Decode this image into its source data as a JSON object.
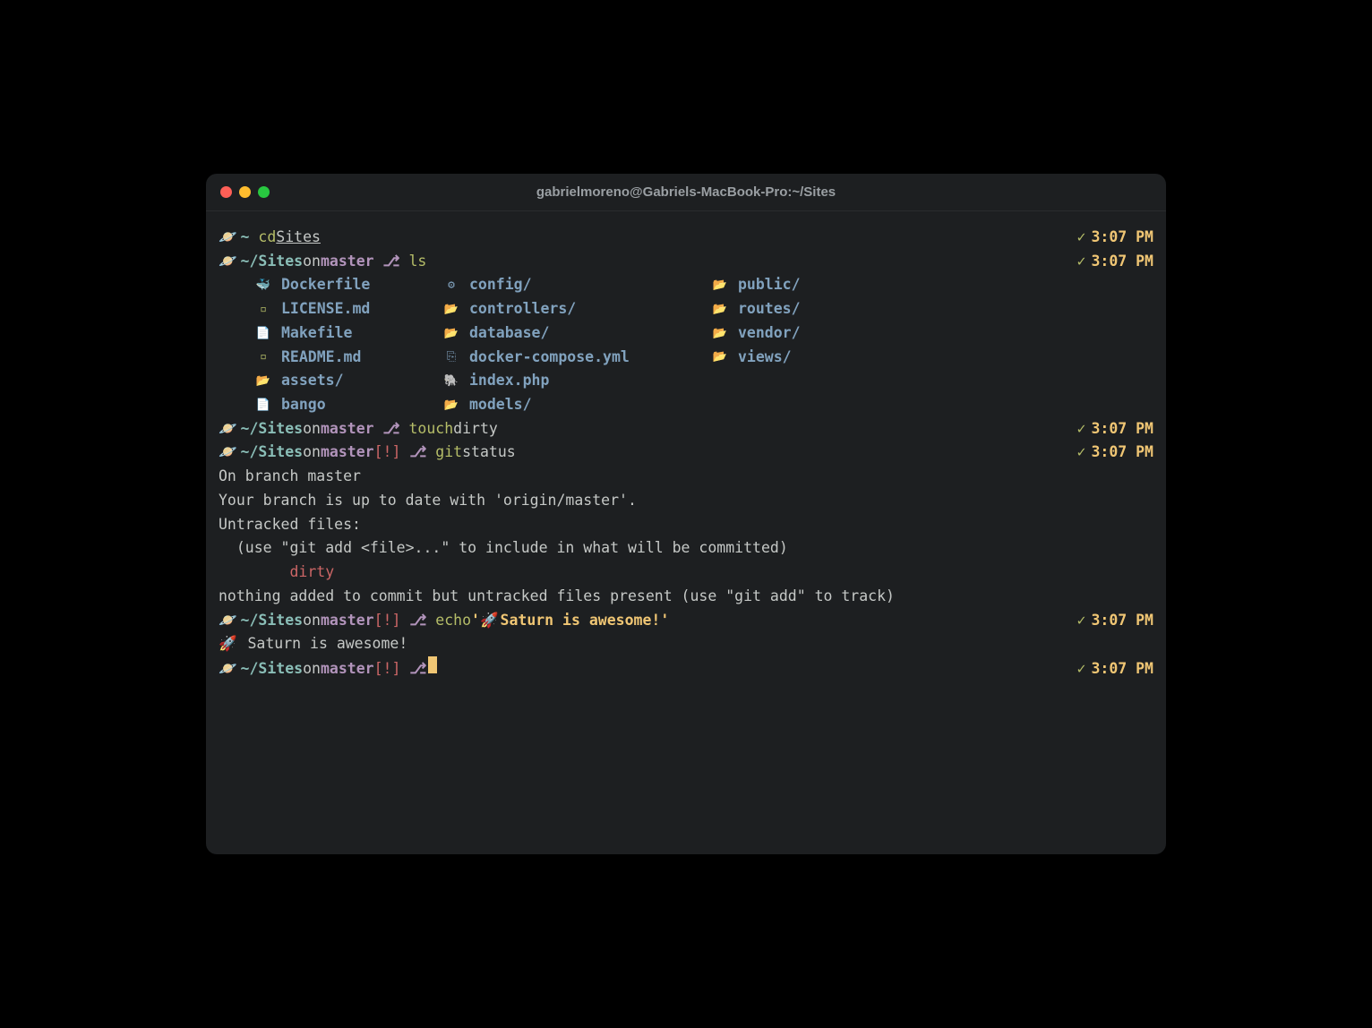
{
  "title": "gabrielmoreno@Gabriels-MacBook-Pro:~/Sites",
  "planet_icon": "🪐",
  "rocket_icon": "🚀",
  "check_icon": "✓",
  "branch_glyph": "⎇",
  "prompts": [
    {
      "path": "~",
      "on": "",
      "branch": "",
      "dirty": "",
      "cmd": "cd ",
      "cmd_arg": "Sites",
      "time": "3:07 PM"
    },
    {
      "path": "~/Sites",
      "on": " on ",
      "branch": "master",
      "dirty": "",
      "cmd": "ls",
      "cmd_arg": "",
      "time": "3:07 PM"
    }
  ],
  "ls": {
    "col1": [
      {
        "icon": "docker",
        "name": "Dockerfile"
      },
      {
        "icon": "md",
        "name": "LICENSE.md"
      },
      {
        "icon": "file",
        "name": "Makefile"
      },
      {
        "icon": "md",
        "name": "README.md"
      },
      {
        "icon": "folder",
        "name": "assets/"
      },
      {
        "icon": "file",
        "name": "bango"
      }
    ],
    "col2": [
      {
        "icon": "config",
        "name": "config/"
      },
      {
        "icon": "folder",
        "name": "controllers/"
      },
      {
        "icon": "folder",
        "name": "database/"
      },
      {
        "icon": "yml",
        "name": "docker-compose.yml"
      },
      {
        "icon": "php",
        "name": "index.php"
      },
      {
        "icon": "folder",
        "name": "models/"
      }
    ],
    "col3": [
      {
        "icon": "folder",
        "name": "public/"
      },
      {
        "icon": "folder",
        "name": "routes/"
      },
      {
        "icon": "folder",
        "name": "vendor/"
      },
      {
        "icon": "folder",
        "name": "views/"
      }
    ]
  },
  "prompt_touch": {
    "path": "~/Sites",
    "on": " on ",
    "branch": "master",
    "dirty": "",
    "cmd": "touch ",
    "cmd_arg": "dirty",
    "time": "3:07 PM"
  },
  "prompt_gitstatus": {
    "path": "~/Sites",
    "on": " on ",
    "branch": "master",
    "dirty": " [!]",
    "cmd": "git ",
    "cmd_arg": "status",
    "time": "3:07 PM"
  },
  "git_output": {
    "l1": "On branch master",
    "l2": "Your branch is up to date with 'origin/master'.",
    "l3": "",
    "l4": "Untracked files:",
    "l5": "  (use \"git add <file>...\" to include in what will be committed)",
    "l6": "        dirty",
    "l7": "",
    "l8": "nothing added to commit but untracked files present (use \"git add\" to track)"
  },
  "prompt_echo": {
    "path": "~/Sites",
    "on": " on ",
    "branch": "master",
    "dirty": " [!]",
    "cmd": "echo ",
    "cmd_arg_pre": "'",
    "cmd_arg_post": " Saturn is awesome!'",
    "time": "3:07 PM"
  },
  "echo_output": " Saturn is awesome!",
  "prompt_final": {
    "path": "~/Sites",
    "on": " on ",
    "branch": "master",
    "dirty": " [!]",
    "time": "3:07 PM"
  }
}
